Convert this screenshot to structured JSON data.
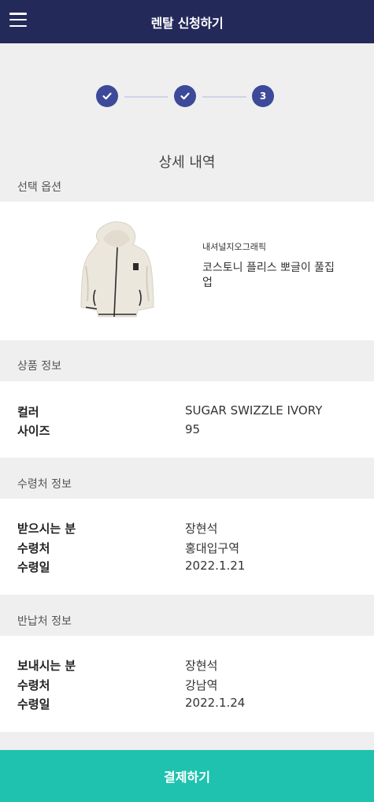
{
  "header": {
    "title": "렌탈 신청하기",
    "menu_icon": "hamburger-menu-icon"
  },
  "stepper": {
    "steps": [
      {
        "state": "done",
        "icon": "check-icon"
      },
      {
        "state": "done",
        "icon": "check-icon"
      },
      {
        "state": "current",
        "label": "3"
      }
    ],
    "accent": "#3d4a9a"
  },
  "page": {
    "heading": "상세 내역"
  },
  "selected_option": {
    "label": "선택 옵션",
    "brand": "내셔널지오그래픽",
    "product_name": "코스토니 플리스 뽀글이 풀집업"
  },
  "product_info": {
    "label": "상품 정보",
    "rows": [
      {
        "key": "컬러",
        "value": "SUGAR SWIZZLE IVORY"
      },
      {
        "key": "사이즈",
        "value": "95"
      }
    ]
  },
  "receive_info": {
    "label": "수령처 정보",
    "rows": [
      {
        "key": "받으시는 분",
        "value": "장현석"
      },
      {
        "key": "수령처",
        "value": "홍대입구역"
      },
      {
        "key": "수령일",
        "value": "2022.1.21"
      }
    ]
  },
  "return_info": {
    "label": "반납처 정보",
    "rows": [
      {
        "key": "보내시는 분",
        "value": "장현석"
      },
      {
        "key": "수령처",
        "value": "강남역"
      },
      {
        "key": "수령일",
        "value": "2022.1.24"
      }
    ]
  },
  "footer": {
    "pay_label": "결제하기",
    "color": "#1fc2ae"
  }
}
